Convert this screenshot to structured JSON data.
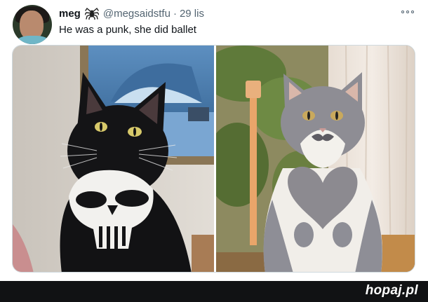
{
  "tweet": {
    "display_name": "meg",
    "handle": "@megsaidstfu",
    "separator": "·",
    "time": "29 lis",
    "text": "He was a punk, she did ballet",
    "name_emoji_icon": "spider-icon",
    "more_icon": "more-horizontal-icon"
  },
  "media": {
    "photos": [
      {
        "subject": "black-and-white-cat-icon"
      },
      {
        "subject": "grey-and-white-cat-icon"
      }
    ]
  },
  "footer": {
    "brand_name": "hopaj",
    "brand_tld": ".pl"
  },
  "colors": {
    "text_primary": "#0f1419",
    "text_secondary": "#536471",
    "footer_bg": "#111214"
  }
}
